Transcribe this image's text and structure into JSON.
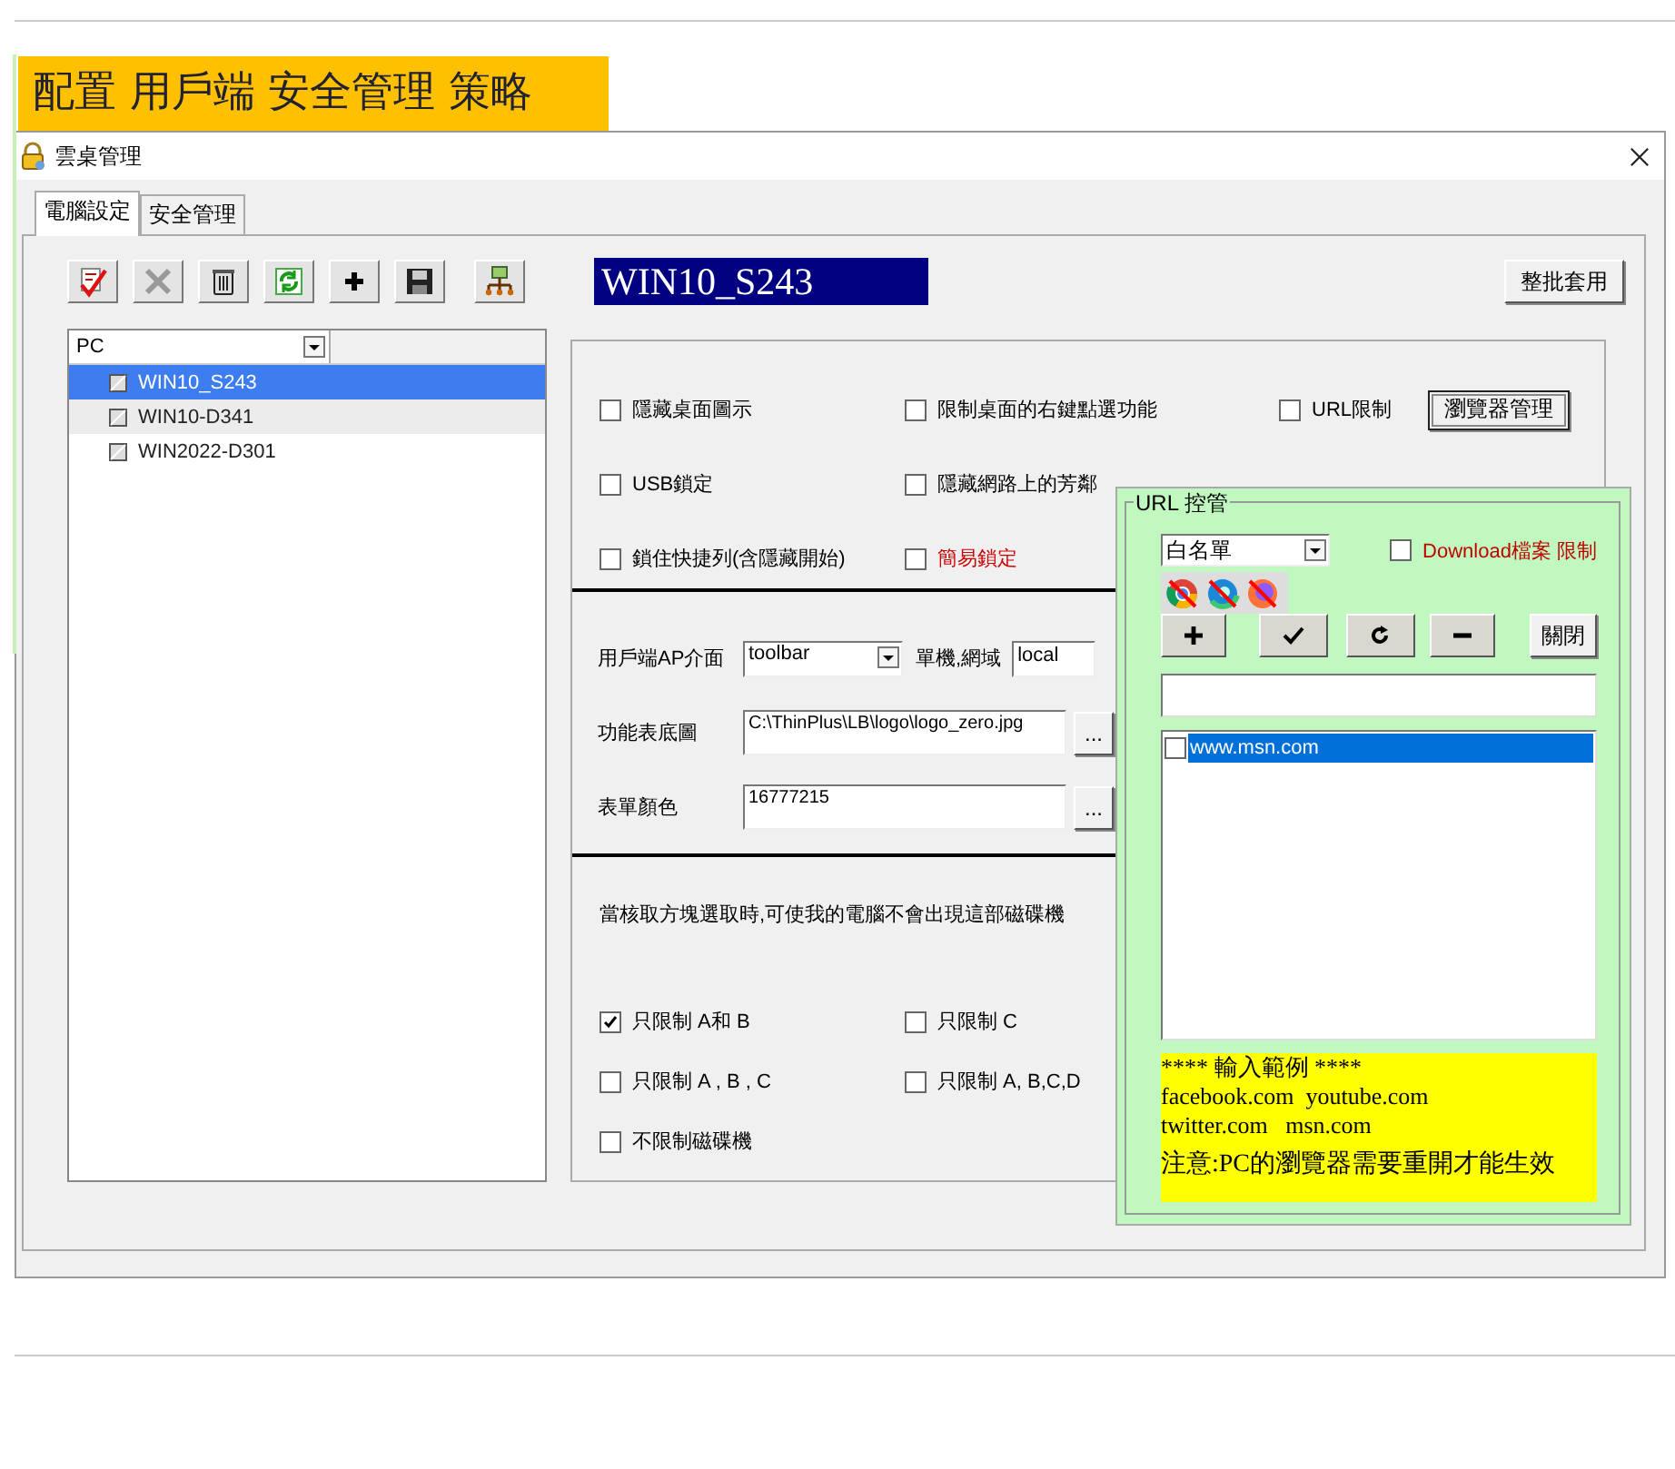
{
  "banner": {
    "title": "配置 用戶端 安全管理 策略"
  },
  "window": {
    "title": "雲桌管理"
  },
  "tabs": [
    {
      "label": "電腦設定",
      "selected": true
    },
    {
      "label": "安全管理",
      "selected": false
    }
  ],
  "selected_pc": "WIN10_S243",
  "batch_button": "整批套用",
  "tree": {
    "header": "PC",
    "items": [
      {
        "label": "WIN10_S243",
        "selected": true
      },
      {
        "label": "WIN10-D341",
        "selected": false
      },
      {
        "label": "WIN2022-D301",
        "selected": false
      }
    ]
  },
  "option_rows": [
    [
      {
        "label": "隱藏桌面圖示",
        "checked": false,
        "color": "#000000"
      },
      {
        "label": "限制桌面的右鍵點選功能",
        "checked": false,
        "color": "#000000"
      },
      {
        "label": "URL限制",
        "checked": false,
        "color": "#000000"
      }
    ],
    [
      {
        "label": "USB鎖定",
        "checked": false,
        "color": "#000000"
      },
      {
        "label": "隱藏網路上的芳鄰",
        "checked": false,
        "color": "#000000"
      }
    ],
    [
      {
        "label": "鎖住快捷列(含隱藏開始)",
        "checked": false,
        "color": "#000000"
      },
      {
        "label": "簡易鎖定",
        "checked": false,
        "color": "#cc0000"
      }
    ]
  ],
  "browser_button": "瀏覽器管理",
  "settings": {
    "client_ap_label": "用戶端AP介面",
    "client_ap_value": "toolbar",
    "domain_label": "單機,網域",
    "domain_value": "local",
    "background_label": "功能表底圖",
    "background_value": "C:\\ThinPlus\\LB\\logo\\logo_zero.jpg",
    "color_label": "表單顏色",
    "color_value": "16777215",
    "browse_button": "..."
  },
  "drives": {
    "note": "當核取方塊選取時,可使我的電腦不會出現這部磁碟機",
    "rows": [
      [
        {
          "label": "只限制 A和 B",
          "checked": true
        },
        {
          "label": "只限制 C",
          "checked": false
        }
      ],
      [
        {
          "label": "只限制 A , B , C",
          "checked": false
        },
        {
          "label": "只限制 A, B,C,D",
          "checked": false
        }
      ],
      [
        {
          "label": "不限制磁碟機",
          "checked": false
        }
      ]
    ]
  },
  "url_panel": {
    "title": "URL 控管",
    "mode": "白名單",
    "download": {
      "label": "Download檔案 限制",
      "checked": false
    },
    "close_button": "關閉",
    "urls": [
      {
        "label": "www.msn.com",
        "checked": false,
        "selected": true
      }
    ],
    "hint": [
      "**** 輸入範例 ****",
      "facebook.com  youtube.com",
      "twitter.com   msn.com"
    ],
    "notice": "注意:PC的瀏覽器需要重開才能生效"
  }
}
